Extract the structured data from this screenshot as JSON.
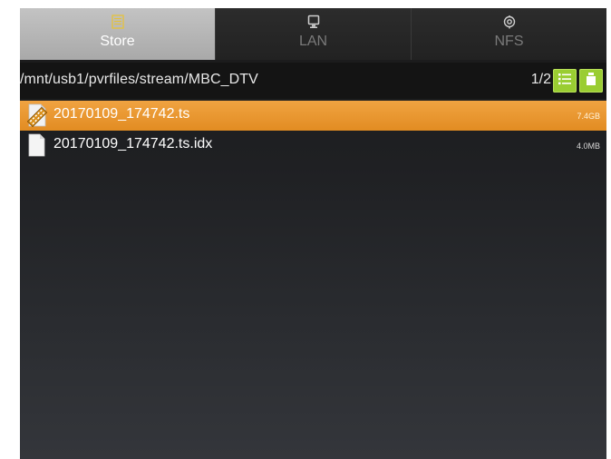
{
  "tabs": [
    {
      "label": "Store",
      "icon": "storage-list-icon",
      "active": true
    },
    {
      "label": "LAN",
      "icon": "monitor-icon",
      "active": false
    },
    {
      "label": "NFS",
      "icon": "network-share-icon",
      "active": false
    }
  ],
  "path_bar": {
    "path": "/mnt/usb1/pvrfiles/stream/MBC_DTV",
    "page_indicator": "1/2",
    "buttons": [
      {
        "icon": "list-view-icon"
      },
      {
        "icon": "new-folder-icon"
      }
    ]
  },
  "files": [
    {
      "name": "20170109_174742.ts",
      "size": "7.4GB",
      "icon": "video-file-icon",
      "selected": true
    },
    {
      "name": "20170109_174742.ts.idx",
      "size": "4.0MB",
      "icon": "document-icon",
      "selected": false
    }
  ],
  "colors": {
    "accent_selection": "#e8951f",
    "button_green": "#9acd32",
    "active_tab": "#b5b5b5"
  }
}
